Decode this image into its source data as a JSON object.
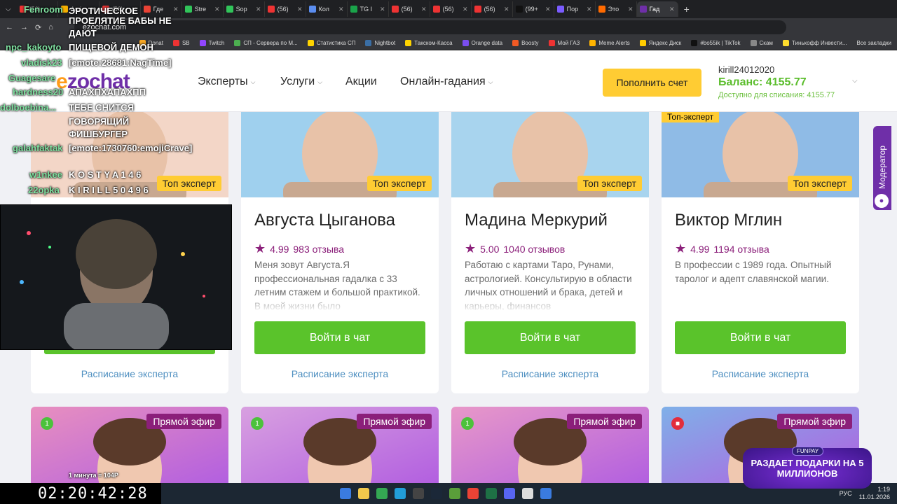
{
  "browser": {
    "tabs": [
      {
        "label": "(56)",
        "color": "#e33"
      },
      {
        "label": "Ami",
        "color": "#f5b000"
      },
      {
        "label": "(56)",
        "color": "#e33"
      },
      {
        "label": "Где",
        "color": "#ea4335"
      },
      {
        "label": "Stre",
        "color": "#31c45a"
      },
      {
        "label": "Sop",
        "color": "#31c45a"
      },
      {
        "label": "(56)",
        "color": "#e33"
      },
      {
        "label": "Кол",
        "color": "#5b8def"
      },
      {
        "label": "TG I",
        "color": "#1aa34a"
      },
      {
        "label": "(56)",
        "color": "#e33"
      },
      {
        "label": "(56)",
        "color": "#e33"
      },
      {
        "label": "(56)",
        "color": "#e33"
      },
      {
        "label": "(99+",
        "color": "#111"
      },
      {
        "label": "Пор",
        "color": "#7b5cff"
      },
      {
        "label": "Это",
        "color": "#ff6a00"
      },
      {
        "label": "Гад",
        "color": "#6f2fa8"
      }
    ],
    "url": "ezochat.com",
    "bookmarks": [
      {
        "label": "Donat",
        "color": "#f6a623"
      },
      {
        "label": "SB",
        "color": "#e33"
      },
      {
        "label": "Twitch",
        "color": "#9146ff"
      },
      {
        "label": "СП - Сервера по М...",
        "color": "#4caf50"
      },
      {
        "label": "Статистика СП",
        "color": "#ffd400"
      },
      {
        "label": "Nightbot",
        "color": "#3a6ea5"
      },
      {
        "label": "Такском-Касса",
        "color": "#ffd400"
      },
      {
        "label": "Orange data",
        "color": "#7a4ef0"
      },
      {
        "label": "Boosty",
        "color": "#f15a24"
      },
      {
        "label": "Мой ГАЗ",
        "color": "#e33"
      },
      {
        "label": "Meme Alerts",
        "color": "#ffb400"
      },
      {
        "label": "Яндекс Диск",
        "color": "#ffcc00"
      },
      {
        "label": "#bo55ik | TikTok",
        "color": "#111"
      },
      {
        "label": "Скам",
        "color": "#888"
      },
      {
        "label": "Тинькофф Инвести...",
        "color": "#ffdd2d"
      }
    ],
    "all_bookmarks": "Все закладки"
  },
  "site": {
    "logo_prefix": "e",
    "logo_rest": "zochat",
    "nav": [
      {
        "label": "Эксперты",
        "has_dropdown": true
      },
      {
        "label": "Услуги",
        "has_dropdown": true
      },
      {
        "label": "Акции",
        "has_dropdown": false
      },
      {
        "label": "Онлайн-гадания",
        "has_dropdown": true
      }
    ],
    "topup_label": "Пополнить счет",
    "username": "kirill24012020",
    "balance": "Баланс: 4155.77",
    "available": "Доступно для списания: 4155.77",
    "moderator_tab": "Модератор"
  },
  "experts": [
    {
      "name": "",
      "badge": "Топ эксперт",
      "rating": "",
      "reviews": "",
      "desc": "",
      "chat_label": "Войти в чат",
      "schedule_label": "Расписание эксперта",
      "photo": "#f3d6c7"
    },
    {
      "name": "Августа Цыганова",
      "badge": "Топ эксперт",
      "rating": "4.99",
      "reviews": "983 отзыва",
      "desc": "Меня зовут Августа.Я профессиональная гадалка с 33 летним стажем и большой практикой. В моей жизни было",
      "chat_label": "Войти в чат",
      "schedule_label": "Расписание эксперта",
      "photo": "#9fd0ee"
    },
    {
      "name": "Мадина Меркурий",
      "badge": "Топ эксперт",
      "rating": "5.00",
      "reviews": "1040 отзывов",
      "desc": "Работаю с картами Таро, Рунами, астрологией. Консультирую в области личных отношений и брака, детей и карьеры, финансов",
      "chat_label": "Войти в чат",
      "schedule_label": "Расписание эксперта",
      "photo": "#a8d4ee"
    },
    {
      "name": "Виктор Мглин",
      "badge": "Топ эксперт",
      "rating": "4.99",
      "reviews": "1194 отзыва",
      "desc": "В профессии с 1989 года. Опытный таролог и адепт славянской магии.",
      "chat_label": "Войти в чат",
      "schedule_label": "Расписание эксперта",
      "photo": "#8fbbe6",
      "corner_badge": "Топ-эксперт"
    }
  ],
  "live_cards": [
    {
      "label": "Прямой эфир",
      "count": "1",
      "photo": "#e88fbf"
    },
    {
      "label": "Прямой эфир",
      "count": "1",
      "photo": "#d8a0e0"
    },
    {
      "label": "Прямой эфир",
      "count": "1",
      "photo": "#e898c8"
    },
    {
      "label": "Прямой эфир",
      "count": "",
      "photo": "#7fb0e8"
    }
  ],
  "stream": {
    "timer": "02:20:42:28",
    "chat": [
      {
        "name": "Fenroom",
        "text": "ЭРОТИЧЕСКОЕ"
      },
      {
        "name": "",
        "text": "ПРОЕЛЯТИЕ БАБЫ НЕ"
      },
      {
        "name": "",
        "text": "ДАЮТ"
      },
      {
        "name": "npc_kakoyto",
        "text": "ПИЩЕВОЙ ДЕМОН"
      },
      {
        "name": "vladisk23",
        "text": "[emote:28681:NagTime]"
      },
      {
        "name": "Guagesare",
        "text": ""
      },
      {
        "name": "hardness20",
        "text": "АПАХПХАПАХПП"
      },
      {
        "name": "dolboebina...",
        "text": "ТЕБЕ СНИТСЯ"
      },
      {
        "name": "",
        "text": "ГОВОРЯЩИЙ"
      },
      {
        "name": "",
        "text": "ФИШБУРГЕР"
      },
      {
        "name": "galahfaktak",
        "text": "[emote:1730760:emojiCrave]"
      },
      {
        "name": "w1nkee",
        "text": "K O S T Y A 1 4 6"
      },
      {
        "name": "22opka",
        "text": "K I R I L L 5 0 4 9 6"
      }
    ],
    "webcam_caption": "1 минута = 104Р",
    "promo_tag": "FUNPAY",
    "promo_text": "РАЗДАЕТ ПОДАРКИ НА 5 МИЛЛИОНОВ"
  },
  "tray": {
    "lang": "РУС",
    "time": "1:19",
    "date": "11.01.2026"
  }
}
